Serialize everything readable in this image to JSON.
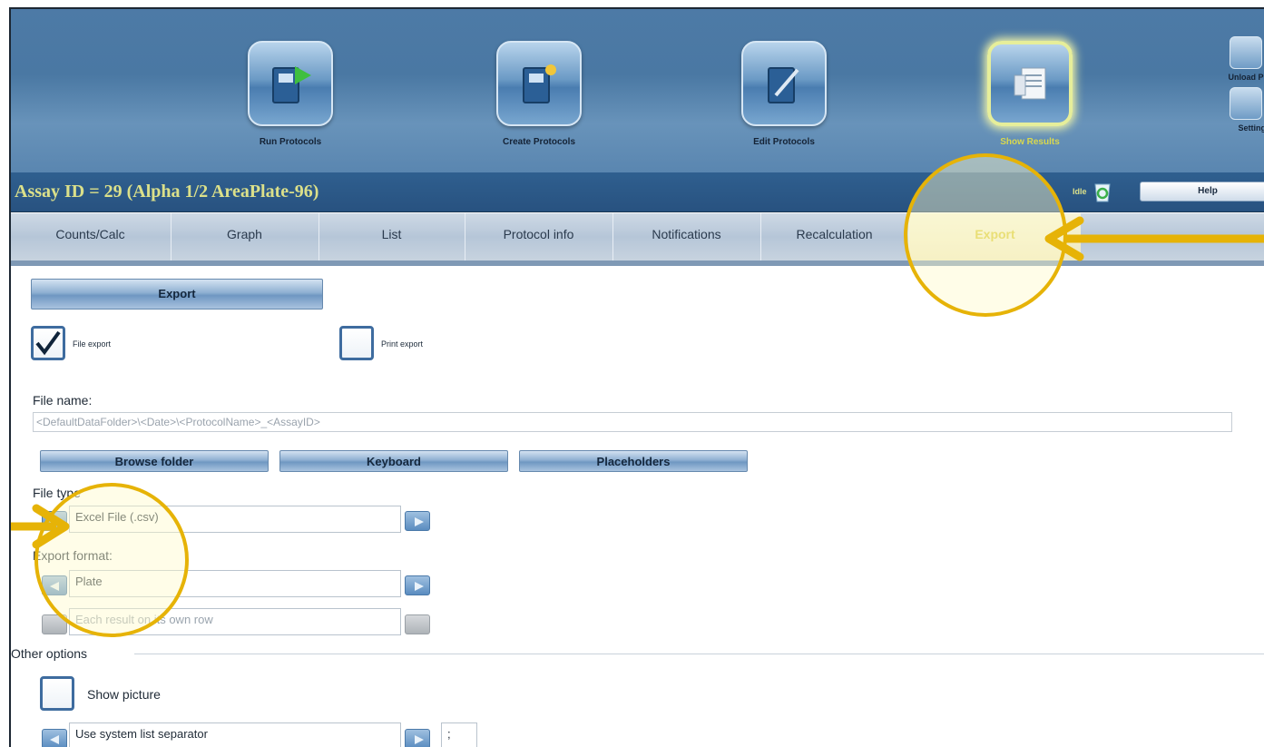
{
  "toolbar": {
    "items": [
      {
        "label": "Run Protocols"
      },
      {
        "label": "Create Protocols"
      },
      {
        "label": "Edit Protocols"
      },
      {
        "label": "Show Results"
      }
    ],
    "side": {
      "unload_label": "Unload Pl",
      "settings_label": "Setting"
    }
  },
  "assay_bar": {
    "title": "Assay ID = 29 (Alpha 1/2 AreaPlate-96)",
    "status": "Idle",
    "help_label": "Help"
  },
  "tabs": [
    {
      "label": "Counts/Calc"
    },
    {
      "label": "Graph"
    },
    {
      "label": "List"
    },
    {
      "label": "Protocol info"
    },
    {
      "label": "Notifications"
    },
    {
      "label": "Recalculation"
    },
    {
      "label": "Export"
    }
  ],
  "export": {
    "button_label": "Export",
    "file_export": {
      "label": "File export",
      "checked": true
    },
    "print_export": {
      "label": "Print export",
      "checked": false
    },
    "file_name_label": "File name:",
    "file_name_value": "<DefaultDataFolder>\\<Date>\\<ProtocolName>_<AssayID>",
    "buttons": {
      "browse": "Browse folder",
      "keyboard": "Keyboard",
      "placeholders": "Placeholders"
    },
    "file_type_label": "File type",
    "file_type_value": "Excel File (.csv)",
    "export_format_label": "Export format:",
    "export_format_value": "Plate",
    "row_option_value": "Each result on its own row",
    "other_options_label": "Other options",
    "show_picture_label": "Show picture",
    "separator_value": "Use system list separator",
    "separator_char": ";"
  },
  "colors": {
    "accent": "#e6b307",
    "toolbar": "#4d7aa6",
    "active_tab_text": "#d8c830"
  }
}
